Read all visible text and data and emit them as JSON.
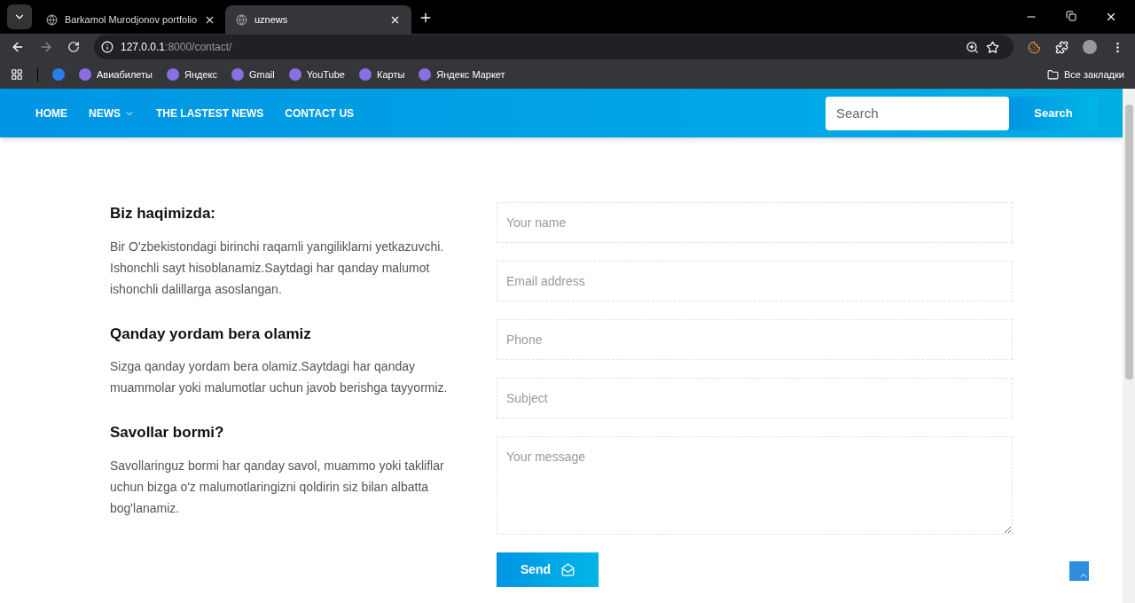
{
  "browser": {
    "tabs": [
      {
        "title": "Barkamol Murodjonov portfolio",
        "selected": false
      },
      {
        "title": "uznews",
        "selected": true
      }
    ],
    "address": {
      "host": "127.0.0.1",
      "rest": ":8000/contact/"
    },
    "bookmarks": [
      "Авиабилеты",
      "Яндекс",
      "Gmail",
      "YouTube",
      "Карты",
      "Яндекс Маркет"
    ],
    "all_bookmarks": "Все закладки"
  },
  "nav": {
    "items": [
      {
        "label": "HOME",
        "dropdown": false
      },
      {
        "label": "NEWS",
        "dropdown": true
      },
      {
        "label": "THE LASTEST NEWS",
        "dropdown": false
      },
      {
        "label": "CONTACT US",
        "dropdown": false
      }
    ],
    "search": {
      "placeholder": "Search",
      "button": "Search"
    }
  },
  "about": [
    {
      "heading": "Biz haqimizda:",
      "text": "Bir O'zbekistondagi birinchi raqamli yangiliklarni yetkazuvchi. Ishonchli sayt hisoblanamiz.Saytdagi har qanday malumot ishonchli dalillarga asoslangan."
    },
    {
      "heading": "Qanday yordam bera olamiz",
      "text": "Sizga qanday yordam bera olamiz.Saytdagi har qanday muammolar yoki malumotlar uchun javob berishga tayyormiz."
    },
    {
      "heading": "Savollar bormi?",
      "text": "Savollaringuz bormi har qanday savol, muammo yoki takliflar uchun bizga o'z malumotlaringizni qoldirin siz bilan albatta bog'lanamiz."
    }
  ],
  "form": {
    "fields": [
      {
        "placeholder": "Your name",
        "kind": "input"
      },
      {
        "placeholder": "Email address",
        "kind": "input"
      },
      {
        "placeholder": "Phone",
        "kind": "input"
      },
      {
        "placeholder": "Subject",
        "kind": "input"
      },
      {
        "placeholder": "Your message",
        "kind": "textarea"
      }
    ],
    "submit": "Send"
  }
}
